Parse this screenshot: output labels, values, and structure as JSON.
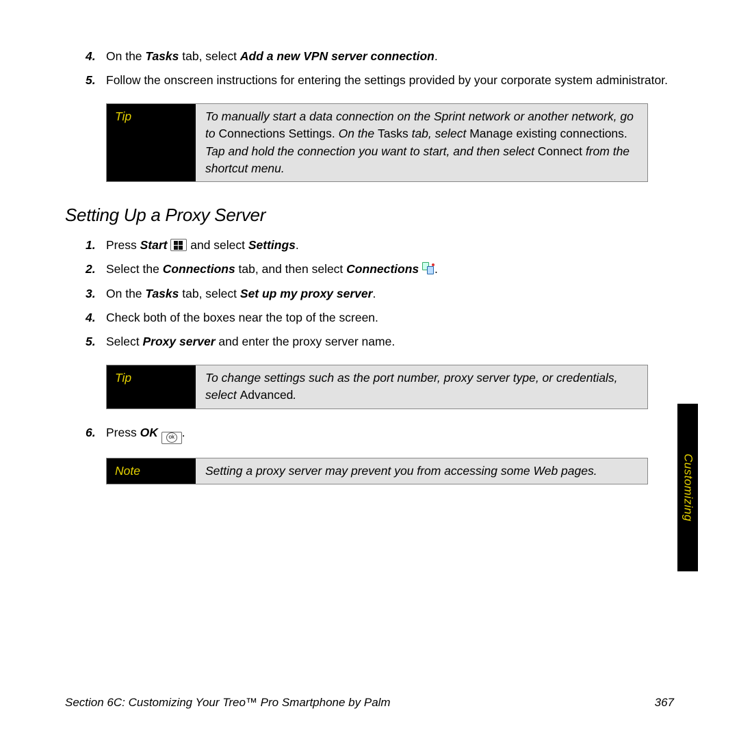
{
  "topSteps": {
    "s4": {
      "num": "4.",
      "pre": "On the ",
      "tasks": "Tasks",
      "mid": " tab, select ",
      "action": "Add a new VPN server connection",
      "post": "."
    },
    "s5": {
      "num": "5.",
      "text": "Follow the onscreen instructions for entering the settings provided by your corporate system administrator."
    }
  },
  "tip1": {
    "label": "Tip",
    "t1": "To manually start a data connection on the Sprint network or another network, go to ",
    "b1": "Connections Settings.",
    "t2": " On the ",
    "b2": "Tasks",
    "t3": " tab, select ",
    "b3": "Manage existing connections.",
    "t4": " Tap and hold the connection you want to start, and then select ",
    "b4": "Connect",
    "t5": " from the shortcut menu."
  },
  "heading": "Setting Up a Proxy Server",
  "proxySteps": {
    "s1": {
      "num": "1.",
      "a": "Press ",
      "b": "Start",
      "c": " and select ",
      "d": "Settings",
      "e": "."
    },
    "s2": {
      "num": "2.",
      "a": "Select the ",
      "b": "Connections",
      "c": " tab, and then select ",
      "d": "Connections",
      "e": "."
    },
    "s3": {
      "num": "3.",
      "a": "On the ",
      "b": "Tasks",
      "c": " tab, select ",
      "d": "Set up my proxy server",
      "e": "."
    },
    "s4": {
      "num": "4.",
      "text": "Check both of the boxes near the top of the screen."
    },
    "s5": {
      "num": "5.",
      "a": "Select ",
      "b": "Proxy server",
      "c": " and enter the proxy server name."
    },
    "s6": {
      "num": "6.",
      "a": "Press ",
      "b": "OK",
      "c": "."
    }
  },
  "tip2": {
    "label": "Tip",
    "t1": "To change settings such as the port number, proxy server type, or credentials, select ",
    "b1": "Advanced",
    "t2": "."
  },
  "note": {
    "label": "Note",
    "text": "Setting a proxy server may prevent you from accessing some Web pages."
  },
  "sidetab": "Customizing",
  "footer": {
    "left": "Section 6C: Customizing Your Treo™ Pro Smartphone by Palm",
    "right": "367"
  }
}
